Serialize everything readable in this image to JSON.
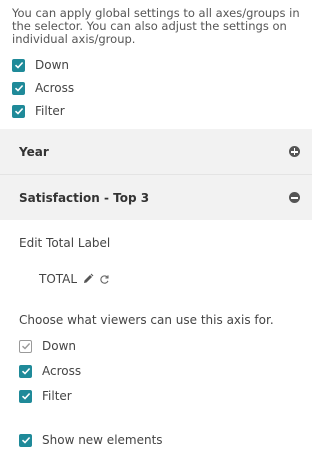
{
  "intro": {
    "text": "You can apply global settings to all axes/groups in the selector. You can also adjust the settings on individual axis/group."
  },
  "global_options": [
    {
      "label": "Down",
      "checked": true
    },
    {
      "label": "Across",
      "checked": true
    },
    {
      "label": "Filter",
      "checked": true
    }
  ],
  "sections": {
    "year": {
      "title": "Year",
      "expanded": false,
      "icon": "plus-circle-icon"
    },
    "satisfaction": {
      "title": "Satisfaction - Top 3",
      "expanded": true,
      "icon": "minus-circle-icon"
    }
  },
  "edit_total": {
    "heading": "Edit Total Label",
    "value": "TOTAL",
    "edit_icon": "pencil-icon",
    "reset_icon": "refresh-icon"
  },
  "usage": {
    "heading": "Choose what viewers can use this axis for.",
    "options": [
      {
        "label": "Down",
        "checked": true,
        "disabled": true
      },
      {
        "label": "Across",
        "checked": true,
        "disabled": false
      },
      {
        "label": "Filter",
        "checked": true,
        "disabled": false
      }
    ]
  },
  "show_new": {
    "label": "Show new elements",
    "checked": true
  },
  "colors": {
    "accent": "#1f8a99",
    "section_bg": "#f2f2f2",
    "text": "#444444"
  }
}
